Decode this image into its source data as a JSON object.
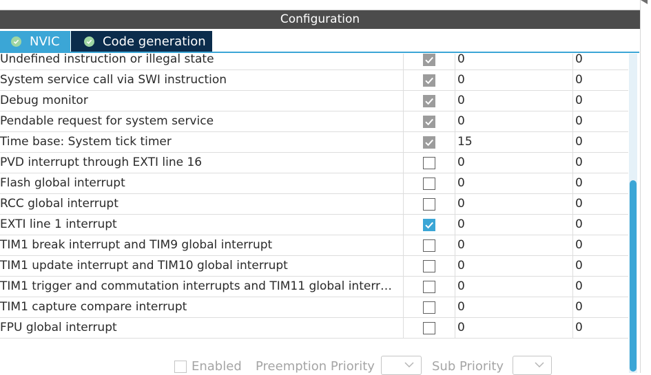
{
  "header": {
    "title": "Configuration"
  },
  "tabs": [
    {
      "label": "NVIC",
      "icon": "check-circle-icon",
      "active": false
    },
    {
      "label": "Code generation",
      "icon": "check-circle-icon",
      "active": true
    }
  ],
  "table": {
    "rows": [
      {
        "name": "Undefined instruction or illegal state",
        "enabled": "disabled-checked",
        "preemption": "0",
        "sub": "0"
      },
      {
        "name": "System service call via SWI instruction",
        "enabled": "disabled-checked",
        "preemption": "0",
        "sub": "0"
      },
      {
        "name": "Debug monitor",
        "enabled": "disabled-checked",
        "preemption": "0",
        "sub": "0"
      },
      {
        "name": "Pendable request for system service",
        "enabled": "disabled-checked",
        "preemption": "0",
        "sub": "0"
      },
      {
        "name": "Time base: System tick timer",
        "enabled": "disabled-checked",
        "preemption": "15",
        "sub": "0"
      },
      {
        "name": "PVD interrupt through EXTI line 16",
        "enabled": "unchecked",
        "preemption": "0",
        "sub": "0"
      },
      {
        "name": "Flash global interrupt",
        "enabled": "unchecked",
        "preemption": "0",
        "sub": "0"
      },
      {
        "name": "RCC global interrupt",
        "enabled": "unchecked",
        "preemption": "0",
        "sub": "0"
      },
      {
        "name": "EXTI line 1 interrupt",
        "enabled": "checked",
        "preemption": "0",
        "sub": "0"
      },
      {
        "name": "TIM1 break interrupt and TIM9 global interrupt",
        "enabled": "unchecked",
        "preemption": "0",
        "sub": "0"
      },
      {
        "name": "TIM1 update interrupt and TIM10 global interrupt",
        "enabled": "unchecked",
        "preemption": "0",
        "sub": "0"
      },
      {
        "name": "TIM1 trigger and commutation interrupts and TIM11 global interr…",
        "enabled": "unchecked",
        "preemption": "0",
        "sub": "0"
      },
      {
        "name": "TIM1 capture compare interrupt",
        "enabled": "unchecked",
        "preemption": "0",
        "sub": "0"
      },
      {
        "name": "FPU global interrupt",
        "enabled": "unchecked",
        "preemption": "0",
        "sub": "0"
      }
    ]
  },
  "bottom": {
    "enabled_label": "Enabled",
    "preemption_label": "Preemption Priority",
    "sub_label": "Sub Priority",
    "preemption_value": "",
    "sub_value": ""
  },
  "colors": {
    "header_bg": "#4c4c4c",
    "tab_nvic": "#3ba6d6",
    "tab_codegen": "#0b2c4c",
    "accent": "#3ba6d6",
    "tab_icon": "#9fd6a3"
  }
}
